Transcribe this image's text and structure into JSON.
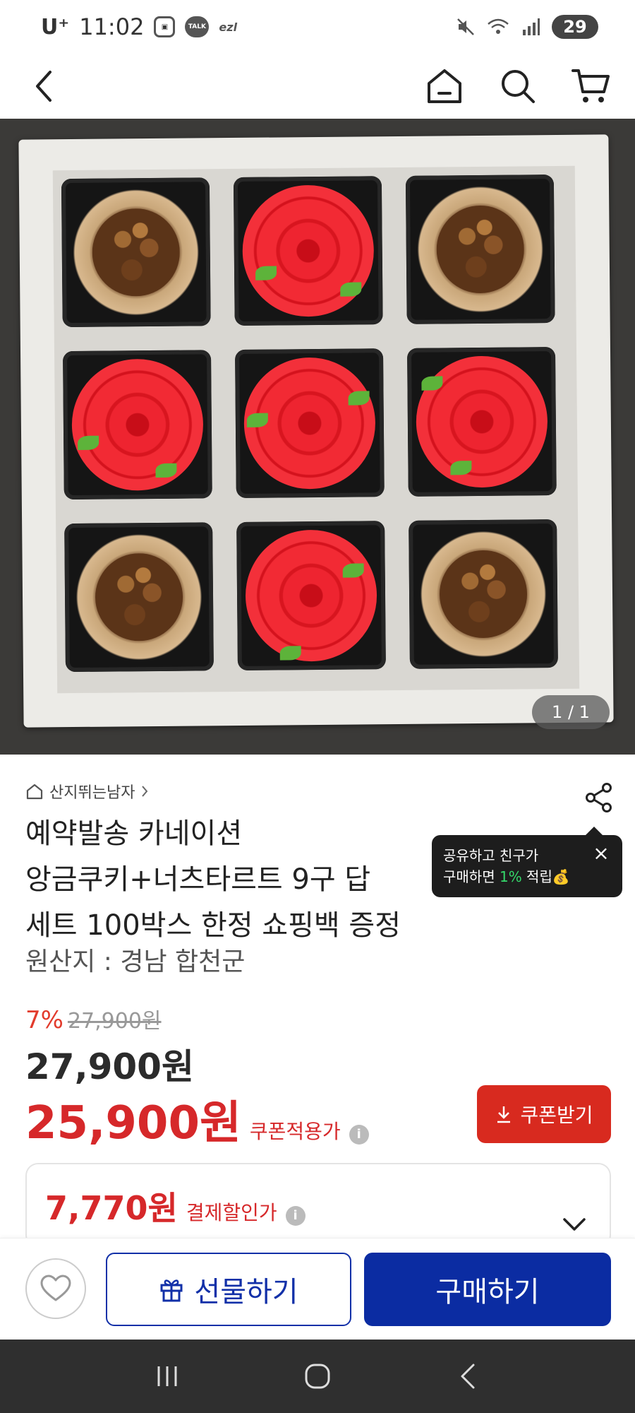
{
  "status": {
    "carrier": "U⁺",
    "time": "11:02",
    "talk": "TALK",
    "ezl": "ezl",
    "battery": "29"
  },
  "product": {
    "image_counter": "1 / 1",
    "store_name": "산지뛰는남자",
    "title_line1": "예약발송 카네이션",
    "title_line2": "앙금쿠키+너츠타르트 9구 답",
    "title_line3": "세트 100박스 한정 쇼핑백 증정",
    "origin": "원산지 : 경남 합천군"
  },
  "tooltip": {
    "line1": "공유하고 친구가",
    "line2_prefix": "구매하면 ",
    "line2_pct": "1%",
    "line2_suffix": " 적립",
    "bag": "💰"
  },
  "price": {
    "discount_pct": "7%",
    "original": "27,900원",
    "sale": "27,900원",
    "coupon_price": "25,900원",
    "coupon_label": "쿠폰적용가",
    "coupon_button": "쿠폰받기",
    "pay_price": "7,770원",
    "pay_label": "결제할인가",
    "info_glyph": "i"
  },
  "actions": {
    "gift": "선물하기",
    "buy": "구매하기"
  },
  "colors": {
    "accent_red": "#d6282a",
    "primary_blue": "#0b2ca2"
  }
}
